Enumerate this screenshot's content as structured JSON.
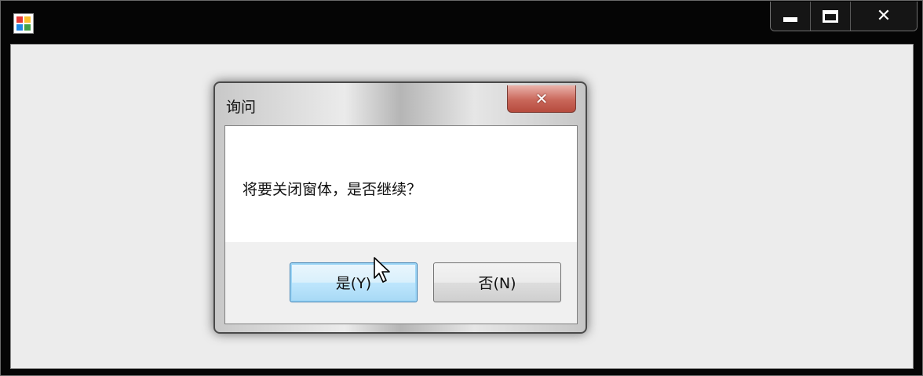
{
  "main_window": {
    "app_icon": "app-icon",
    "caption_buttons": {
      "minimize": "minimize-icon",
      "maximize": "maximize-icon",
      "close_glyph": "✕"
    }
  },
  "dialog": {
    "title": "询问",
    "close_glyph": "✕",
    "message": "将要关闭窗体，是否继续？",
    "buttons": {
      "yes_label": "是(Y)",
      "no_label": "否(N)"
    }
  },
  "cursor": "arrow-cursor-icon"
}
